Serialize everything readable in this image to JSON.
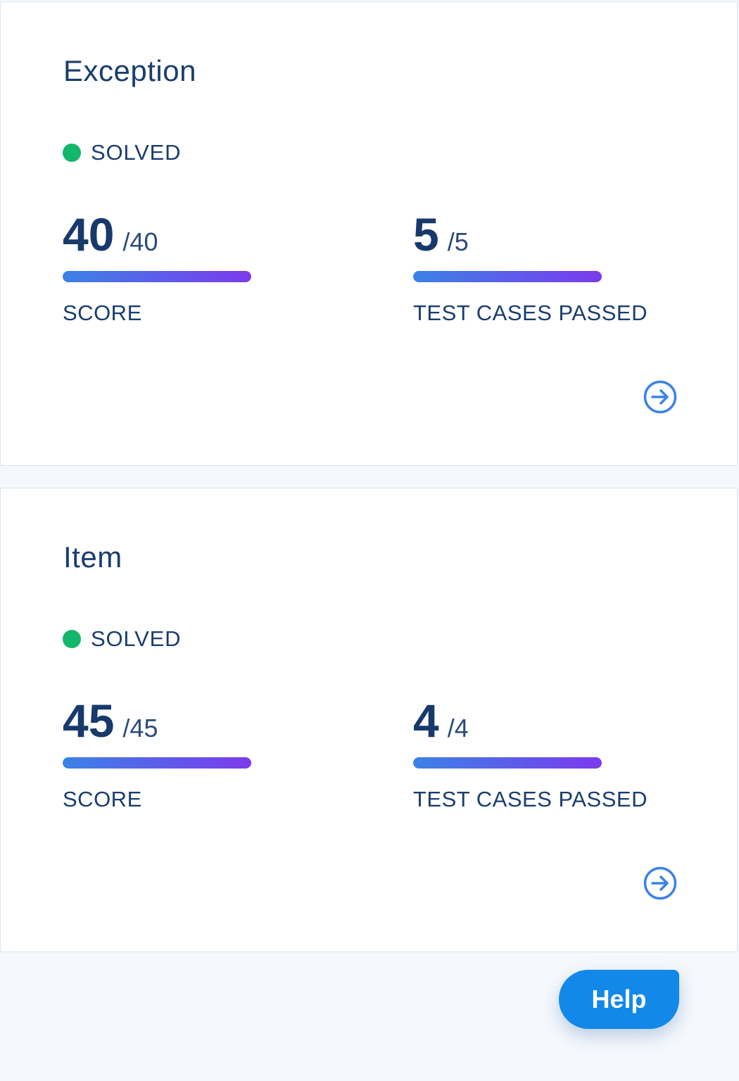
{
  "cards": [
    {
      "title": "Exception",
      "status": "SOLVED",
      "score": {
        "value": "40",
        "total": "/40",
        "fraction": 1.0,
        "label": "SCORE"
      },
      "tests": {
        "value": "5",
        "total": "/5",
        "fraction": 1.0,
        "label": "TEST CASES PASSED"
      },
      "status_color": "#12b76a",
      "nav_icon": "arrow-right-circle-icon"
    },
    {
      "title": "Item",
      "status": "SOLVED",
      "score": {
        "value": "45",
        "total": "/45",
        "fraction": 1.0,
        "label": "SCORE"
      },
      "tests": {
        "value": "4",
        "total": "/4",
        "fraction": 1.0,
        "label": "TEST CASES PASSED"
      },
      "status_color": "#12b76a",
      "nav_icon": "arrow-right-circle-icon"
    }
  ],
  "help_button": {
    "label": "Help",
    "color": "#1288e8"
  },
  "colors": {
    "accent_blue": "#3b82e6",
    "accent_purple": "#7c3aed",
    "text_dark": "#1a3d6e"
  }
}
